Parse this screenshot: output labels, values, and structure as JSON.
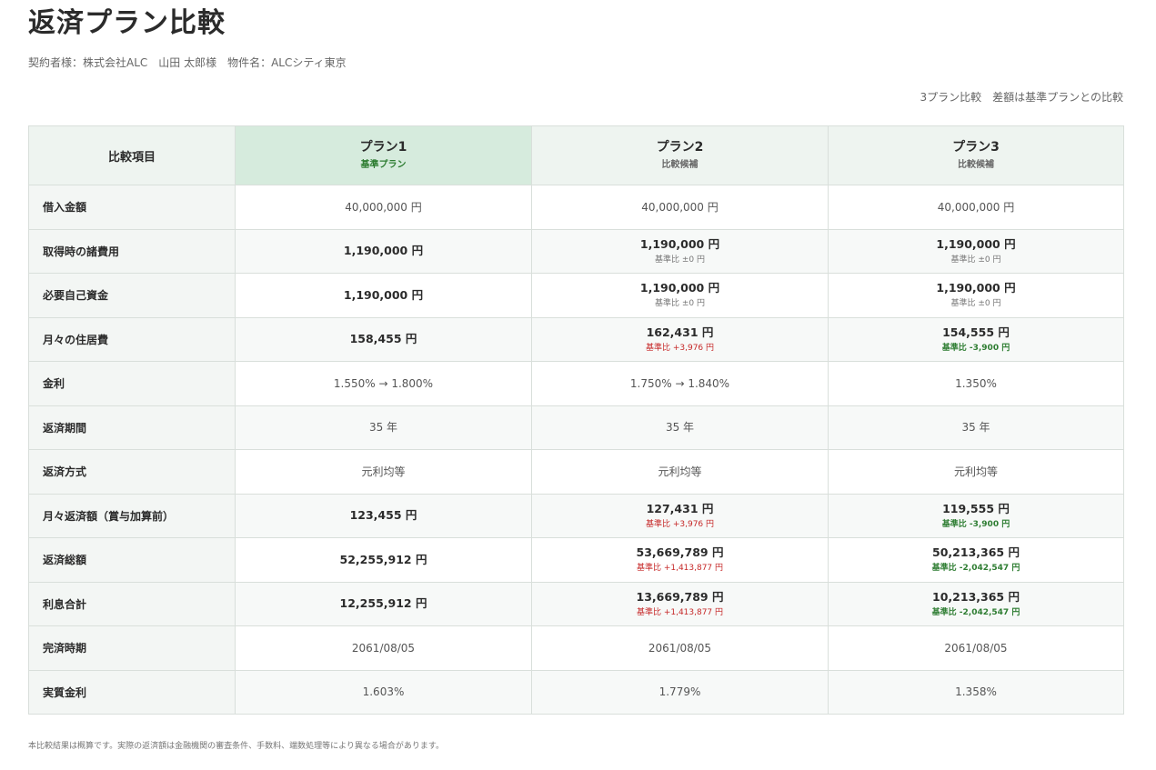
{
  "title": "返済プラン比較",
  "meta": "契約者様：株式会社ALC　山田 太郎様　物件名：ALCシティ東京",
  "right_note": "3プラン比較　差額は基準プランとの比較",
  "header": {
    "item": "比較項目",
    "plans": [
      {
        "name": "プラン1",
        "sub": "基準プラン"
      },
      {
        "name": "プラン2",
        "sub": "比較候補"
      },
      {
        "name": "プラン3",
        "sub": "比較候補"
      }
    ]
  },
  "rows": [
    {
      "label": "借入金額",
      "cells": [
        {
          "v": "40,000,000 円"
        },
        {
          "v": "40,000,000 円"
        },
        {
          "v": "40,000,000 円"
        }
      ]
    },
    {
      "label": "取得時の諸費用",
      "cells": [
        {
          "v": "1,190,000 円"
        },
        {
          "v": "1,190,000 円",
          "d": "基準比 ±0 円"
        },
        {
          "v": "1,190,000 円",
          "d": "基準比 ±0 円"
        }
      ]
    },
    {
      "label": "必要自己資金",
      "cells": [
        {
          "v": "1,190,000 円"
        },
        {
          "v": "1,190,000 円",
          "d": "基準比 ±0 円"
        },
        {
          "v": "1,190,000 円",
          "d": "基準比 ±0 円"
        }
      ]
    },
    {
      "label": "月々の住居費",
      "cells": [
        {
          "v": "158,455 円"
        },
        {
          "v": "162,431 円",
          "d": "基準比 +3,976 円"
        },
        {
          "v": "154,555 円",
          "d": "基準比 -3,900 円"
        }
      ]
    },
    {
      "label": "金利",
      "cells": [
        {
          "v": "1.550% → 1.800%"
        },
        {
          "v": "1.750% → 1.840%"
        },
        {
          "v": "1.350%"
        }
      ]
    },
    {
      "label": "返済期間",
      "cells": [
        {
          "v": "35 年"
        },
        {
          "v": "35 年"
        },
        {
          "v": "35 年"
        }
      ]
    },
    {
      "label": "返済方式",
      "cells": [
        {
          "v": "元利均等"
        },
        {
          "v": "元利均等"
        },
        {
          "v": "元利均等"
        }
      ]
    },
    {
      "label": "月々返済額（賞与加算前）",
      "cells": [
        {
          "v": "123,455 円"
        },
        {
          "v": "127,431 円",
          "d": "基準比 +3,976 円"
        },
        {
          "v": "119,555 円",
          "d": "基準比 -3,900 円"
        }
      ]
    },
    {
      "label": "返済総額",
      "cells": [
        {
          "v": "52,255,912 円"
        },
        {
          "v": "53,669,789 円",
          "d": "基準比 +1,413,877 円"
        },
        {
          "v": "50,213,365 円",
          "d": "基準比 -2,042,547 円"
        }
      ]
    },
    {
      "label": "利息合計",
      "cells": [
        {
          "v": "12,255,912 円"
        },
        {
          "v": "13,669,789 円",
          "d": "基準比 +1,413,877 円"
        },
        {
          "v": "10,213,365 円",
          "d": "基準比 -2,042,547 円"
        }
      ]
    },
    {
      "label": "完済時期",
      "cells": [
        {
          "v": "2061/08/05"
        },
        {
          "v": "2061/08/05"
        },
        {
          "v": "2061/08/05"
        }
      ]
    },
    {
      "label": "実質金利",
      "cells": [
        {
          "v": "1.603%"
        },
        {
          "v": "1.779%"
        },
        {
          "v": "1.358%"
        }
      ]
    }
  ],
  "footnote": "本比較結果は概算です。実際の返済額は金融機関の審査条件、手数料、端数処理等により異なる場合があります。"
}
